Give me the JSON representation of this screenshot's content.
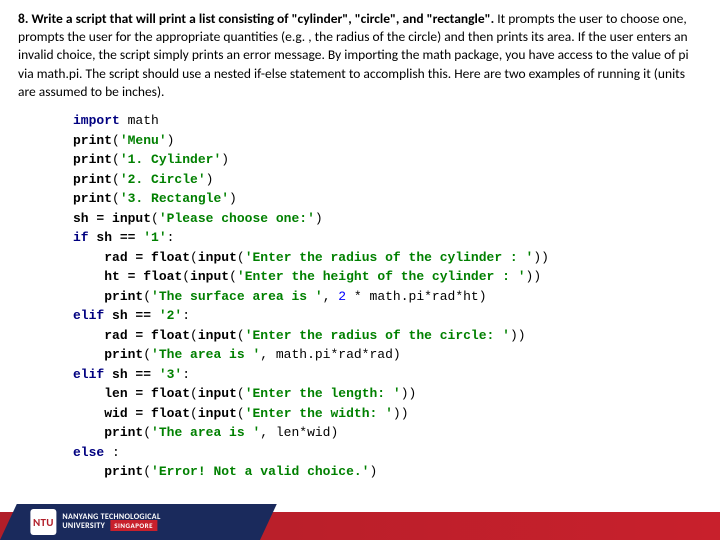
{
  "question": {
    "number": "8.",
    "prompt_bold": "Write a script that will print a list consisting of \"cylinder\", \"circle\", and \"rectangle\".",
    "prompt_rest": " It prompts the user to choose one, prompts the user for the appropriate quantities (e.g. , the radius of the circle) and then prints its area. If the user enters an invalid choice, the script simply prints an error message. By importing the math package, you have access to the value of pi via math.pi. The script should use a nested if-else statement to accomplish this. Here are two examples of running it (units are assumed to be inches)."
  },
  "code": {
    "l01a": "import",
    "l01b": " math",
    "l02a": "print",
    "l02b": "(",
    "l02c": "'Menu'",
    "l02d": ")",
    "l03a": "print",
    "l03b": "(",
    "l03c": "'1. Cylinder'",
    "l03d": ")",
    "l04a": "print",
    "l04b": "(",
    "l04c": "'2. Circle'",
    "l04d": ")",
    "l05a": "print",
    "l05b": "(",
    "l05c": "'3. Rectangle'",
    "l05d": ")",
    "l06a": "sh = ",
    "l06b": "input",
    "l06c": "(",
    "l06d": "'Please choose one:'",
    "l06e": ")",
    "l07a": "if",
    "l07b": " sh == ",
    "l07c": "'1'",
    "l07d": ":",
    "l08i": "    ",
    "l08a": "rad = ",
    "l08b": "float",
    "l08c": "(",
    "l08d": "input",
    "l08e": "(",
    "l08f": "'Enter the radius of the cylinder : '",
    "l08g": "))",
    "l09i": "    ",
    "l09a": "ht = ",
    "l09b": "float",
    "l09c": "(",
    "l09d": "input",
    "l09e": "(",
    "l09f": "'Enter the height of the cylinder : '",
    "l09g": "))",
    "l10i": "    ",
    "l10a": "print",
    "l10b": "(",
    "l10c": "'The surface area is '",
    "l10d": ", ",
    "l10e": "2",
    "l10f": " * math.pi*rad*ht)",
    "l11a": "elif",
    "l11b": " sh == ",
    "l11c": "'2'",
    "l11d": ":",
    "l12i": "    ",
    "l12a": "rad = ",
    "l12b": "float",
    "l12c": "(",
    "l12d": "input",
    "l12e": "(",
    "l12f": "'Enter the radius of the circle: '",
    "l12g": "))",
    "l13i": "    ",
    "l13a": "print",
    "l13b": "(",
    "l13c": "'The area is '",
    "l13d": ", math.pi*rad*rad)",
    "l14a": "elif",
    "l14b": " sh == ",
    "l14c": "'3'",
    "l14d": ":",
    "l15i": "    ",
    "l15a": "len = ",
    "l15b": "float",
    "l15c": "(",
    "l15d": "input",
    "l15e": "(",
    "l15f": "'Enter the length: '",
    "l15g": "))",
    "l16i": "    ",
    "l16a": "wid = ",
    "l16b": "float",
    "l16c": "(",
    "l16d": "input",
    "l16e": "(",
    "l16f": "'Enter the width: '",
    "l16g": "))",
    "l17i": "    ",
    "l17a": "print",
    "l17b": "(",
    "l17c": "'The area is '",
    "l17d": ", len*wid)",
    "l18a": "else",
    "l18b": " :",
    "l19i": "    ",
    "l19a": "print",
    "l19b": "(",
    "l19c": "'Error! Not a valid choice.'",
    "l19d": ")"
  },
  "footer": {
    "uni1": "NANYANG TECHNOLOGICAL",
    "uni2": "UNIVERSITY",
    "sg": "SINGAPORE",
    "crest": "NTU"
  }
}
